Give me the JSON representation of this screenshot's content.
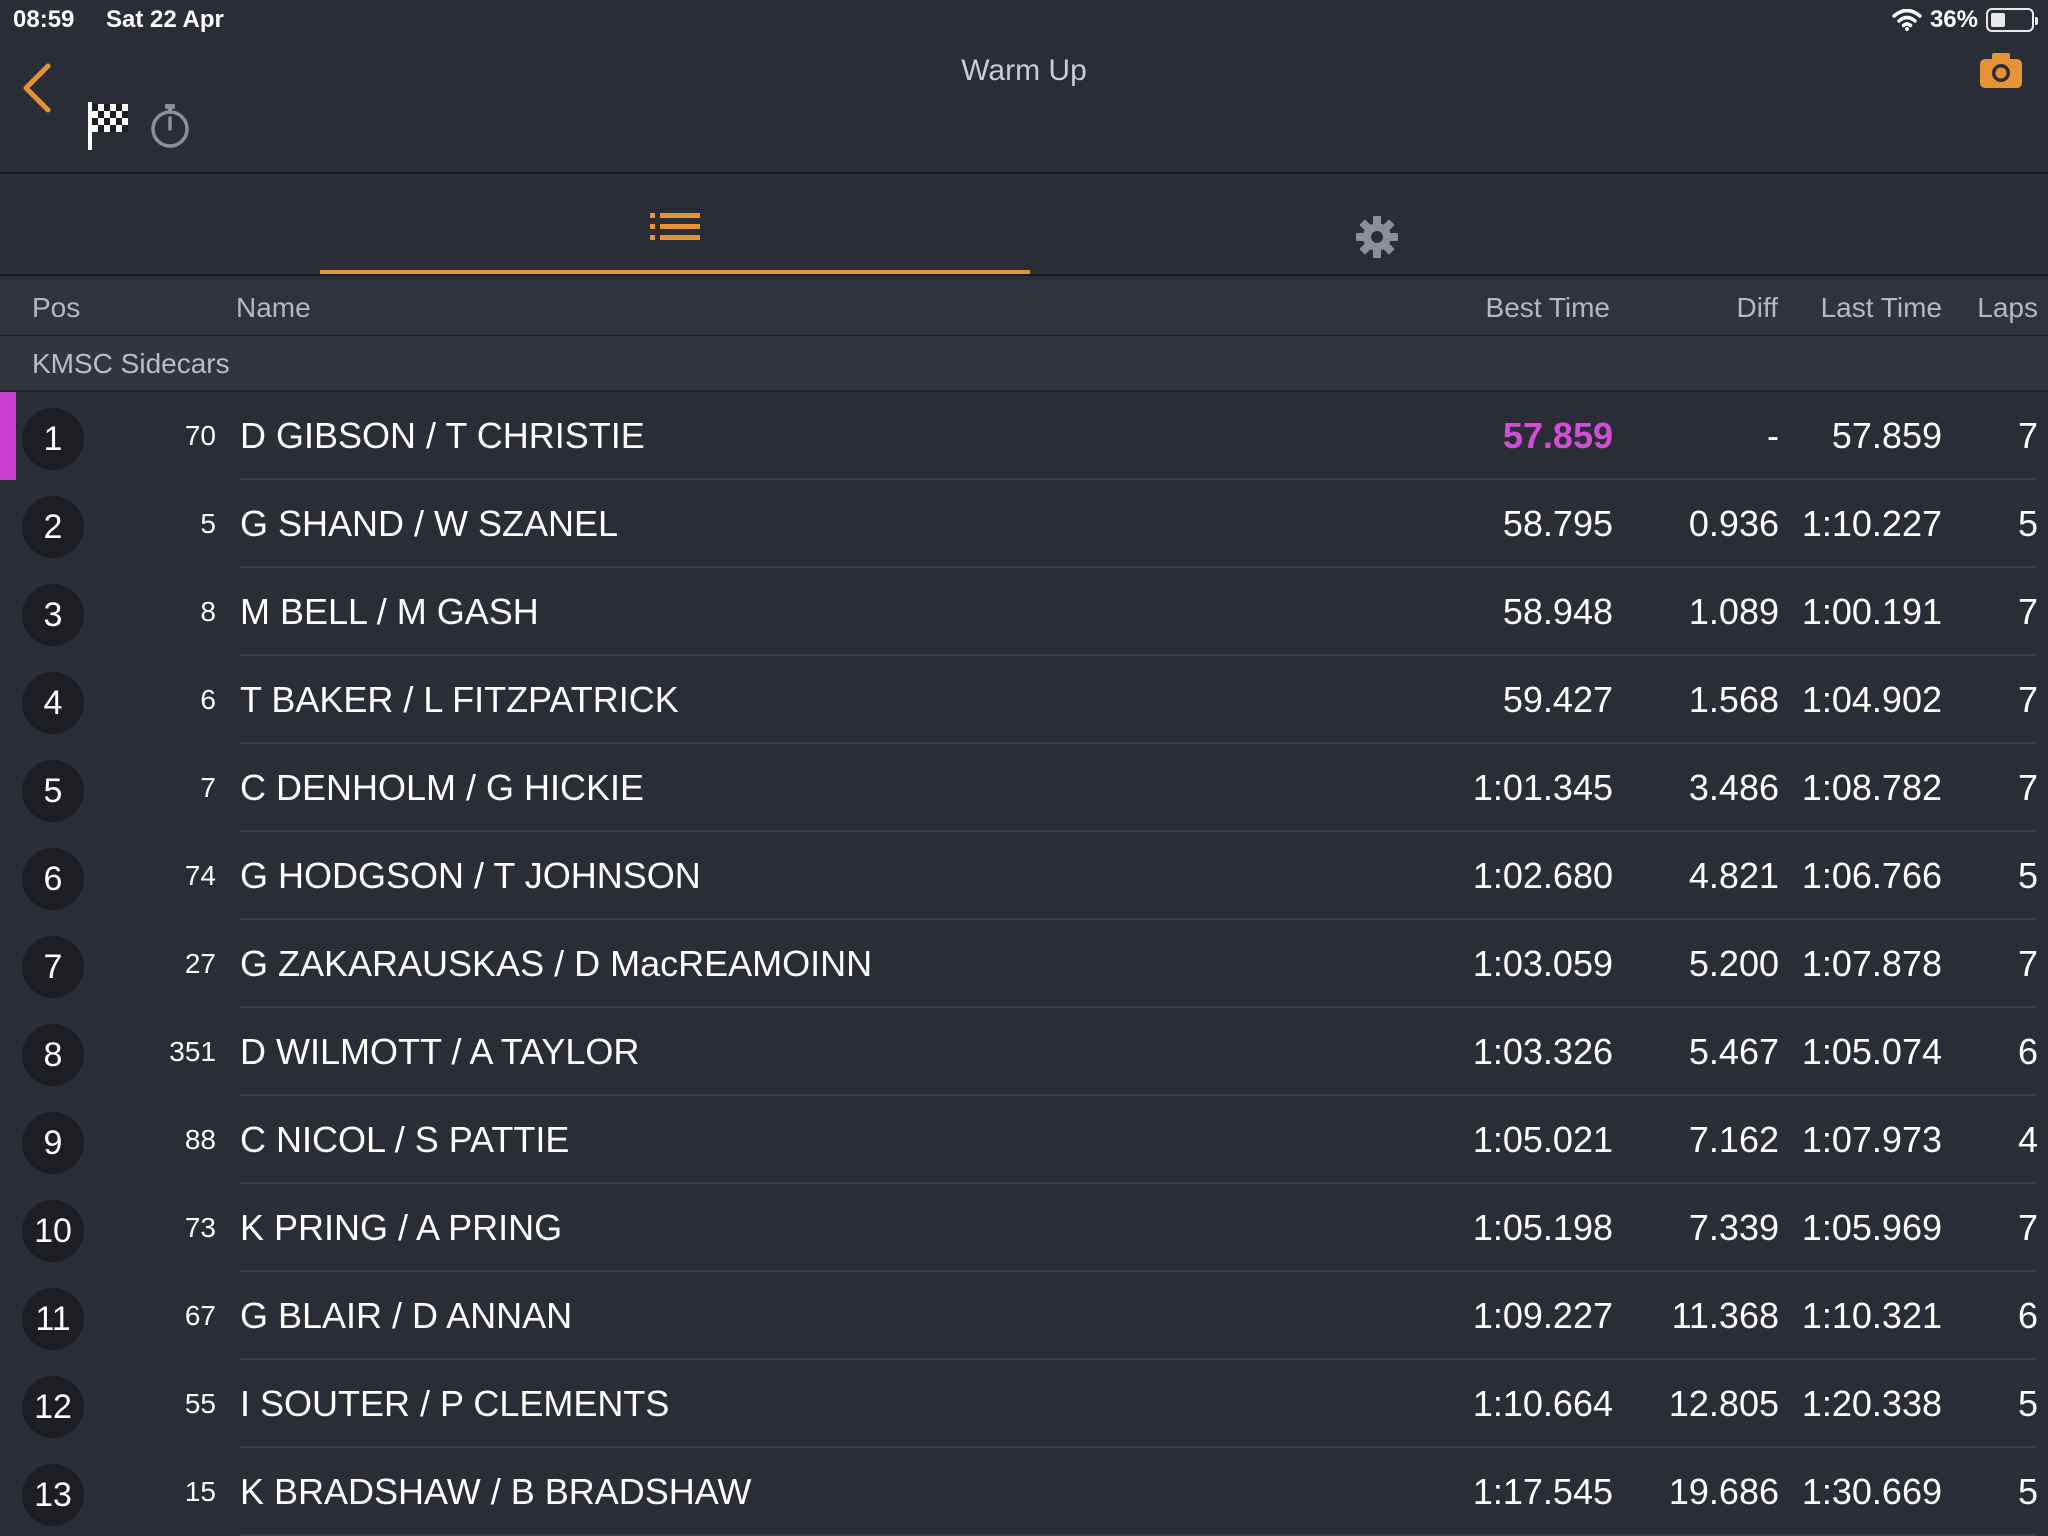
{
  "status_bar": {
    "time": "08:59",
    "date": "Sat 22 Apr",
    "battery": "36%",
    "battery_level": 0.36
  },
  "header": {
    "title": "Warm Up",
    "accent_color": "#e79436"
  },
  "tabs": [
    {
      "icon": "list-icon",
      "active": true
    },
    {
      "icon": "gear-icon",
      "active": false
    }
  ],
  "columns": {
    "pos": "Pos",
    "name": "Name",
    "best": "Best Time",
    "diff": "Diff",
    "last": "Last Time",
    "laps": "Laps"
  },
  "section": {
    "title": "KMSC Sidecars"
  },
  "rows": [
    {
      "pos": "1",
      "num": "70",
      "name": "D GIBSON / T CHRISTIE",
      "best": "57.859",
      "diff": "-",
      "last": "57.859",
      "laps": "7"
    },
    {
      "pos": "2",
      "num": "5",
      "name": "G SHAND / W SZANEL",
      "best": "58.795",
      "diff": "0.936",
      "last": "1:10.227",
      "laps": "5"
    },
    {
      "pos": "3",
      "num": "8",
      "name": "M BELL / M GASH",
      "best": "58.948",
      "diff": "1.089",
      "last": "1:00.191",
      "laps": "7"
    },
    {
      "pos": "4",
      "num": "6",
      "name": "T BAKER / L FITZPATRICK",
      "best": "59.427",
      "diff": "1.568",
      "last": "1:04.902",
      "laps": "7"
    },
    {
      "pos": "5",
      "num": "7",
      "name": "C DENHOLM / G HICKIE",
      "best": "1:01.345",
      "diff": "3.486",
      "last": "1:08.782",
      "laps": "7"
    },
    {
      "pos": "6",
      "num": "74",
      "name": "G HODGSON / T JOHNSON",
      "best": "1:02.680",
      "diff": "4.821",
      "last": "1:06.766",
      "laps": "5"
    },
    {
      "pos": "7",
      "num": "27",
      "name": "G ZAKARAUSKAS / D MacREAMOINN",
      "best": "1:03.059",
      "diff": "5.200",
      "last": "1:07.878",
      "laps": "7"
    },
    {
      "pos": "8",
      "num": "351",
      "name": "D WILMOTT / A TAYLOR",
      "best": "1:03.326",
      "diff": "5.467",
      "last": "1:05.074",
      "laps": "6"
    },
    {
      "pos": "9",
      "num": "88",
      "name": "C NICOL / S PATTIE",
      "best": "1:05.021",
      "diff": "7.162",
      "last": "1:07.973",
      "laps": "4"
    },
    {
      "pos": "10",
      "num": "73",
      "name": "K PRING / A PRING",
      "best": "1:05.198",
      "diff": "7.339",
      "last": "1:05.969",
      "laps": "7"
    },
    {
      "pos": "11",
      "num": "67",
      "name": "G BLAIR / D ANNAN",
      "best": "1:09.227",
      "diff": "11.368",
      "last": "1:10.321",
      "laps": "6"
    },
    {
      "pos": "12",
      "num": "55",
      "name": "I SOUTER / P CLEMENTS",
      "best": "1:10.664",
      "diff": "12.805",
      "last": "1:20.338",
      "laps": "5"
    },
    {
      "pos": "13",
      "num": "15",
      "name": "K BRADSHAW / B BRADSHAW",
      "best": "1:17.545",
      "diff": "19.686",
      "last": "1:30.669",
      "laps": "5"
    }
  ]
}
